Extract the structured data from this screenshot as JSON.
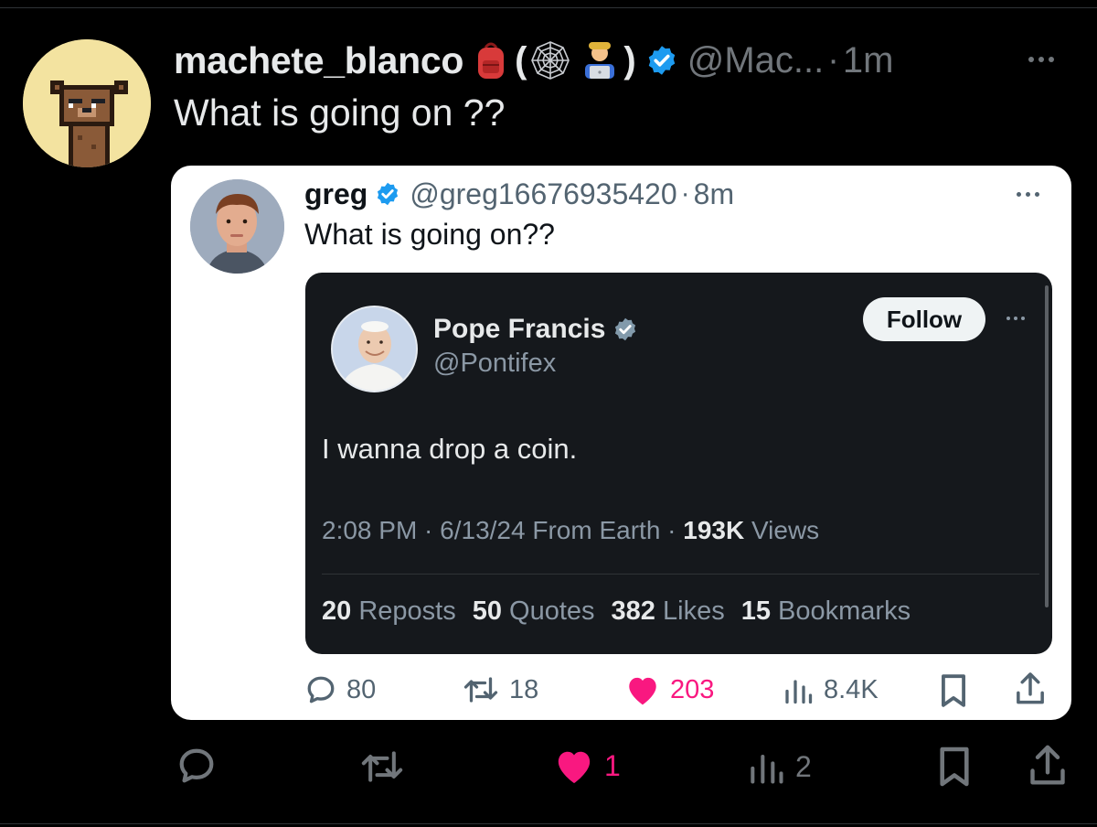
{
  "outer_tweet": {
    "display_name": "machete_blanco",
    "paren_open": "(",
    "paren_close": ")",
    "handle": "@Mac...",
    "separator": "·",
    "time": "1m",
    "text": "What is going on ??",
    "actions": {
      "reply_count": "",
      "repost_count": "",
      "like_count": "1",
      "views_count": "2"
    }
  },
  "quoted_tweet": {
    "display_name": "greg",
    "handle": "@greg16676935420",
    "separator": "·",
    "time": "8m",
    "text": "What is going on??",
    "actions": {
      "reply_count": "80",
      "repost_count": "18",
      "like_count": "203",
      "views_count": "8.4K"
    }
  },
  "embedded_tweet": {
    "display_name": "Pope Francis",
    "handle": "@Pontifex",
    "follow_label": "Follow",
    "text": "I wanna drop a coin.",
    "meta_time": "2:08 PM · 6/13/24 From Earth · ",
    "meta_views_count": "193K",
    "meta_views_label": " Views",
    "stats": [
      {
        "count": "20",
        "label": " Reposts"
      },
      {
        "count": "50",
        "label": " Quotes"
      },
      {
        "count": "382",
        "label": " Likes"
      },
      {
        "count": "15",
        "label": " Bookmarks"
      }
    ]
  },
  "colors": {
    "background": "#000000",
    "verified": "#1d9bf0",
    "like": "#f91880",
    "muted": "#71767b"
  },
  "icons": [
    "backpack-icon",
    "spider-web-icon",
    "technologist-icon",
    "verified-badge-icon",
    "more-icon",
    "reply-icon",
    "repost-icon",
    "heart-icon",
    "views-icon",
    "bookmark-icon",
    "share-icon"
  ]
}
